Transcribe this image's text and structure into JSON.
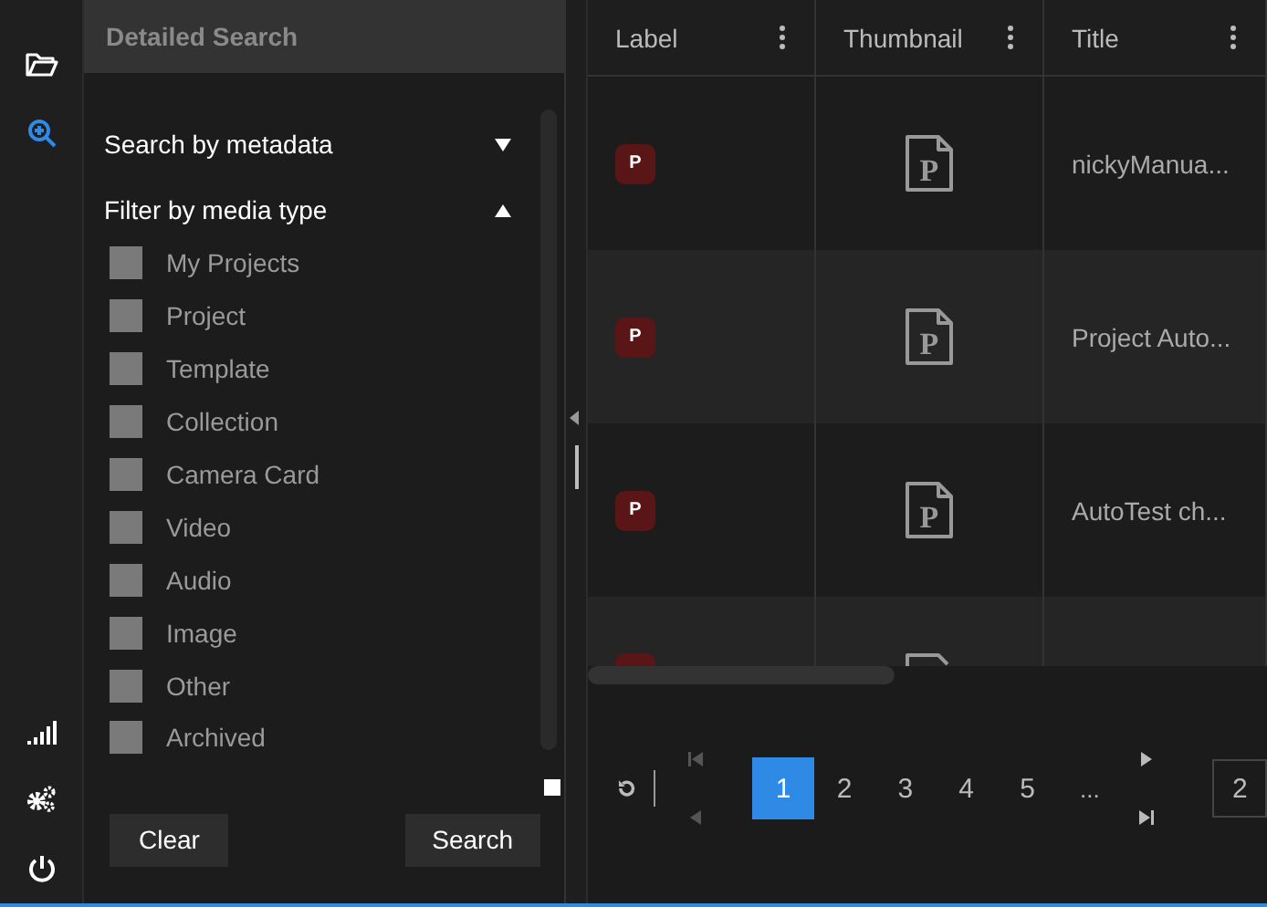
{
  "rail": {
    "items": [
      {
        "kind": "folder",
        "selected": false
      },
      {
        "kind": "zoom",
        "selected": true
      }
    ],
    "bottom": [
      {
        "kind": "signal"
      },
      {
        "kind": "gears"
      },
      {
        "kind": "power"
      }
    ]
  },
  "panel": {
    "title": "Detailed Search",
    "sections": [
      {
        "label": "Search by metadata",
        "expanded": false
      },
      {
        "label": "Filter by media type",
        "expanded": true
      }
    ],
    "media_types": [
      {
        "label": "My Projects",
        "checked": false
      },
      {
        "label": "Project",
        "checked": false
      },
      {
        "label": "Template",
        "checked": false
      },
      {
        "label": "Collection",
        "checked": false
      },
      {
        "label": "Camera Card",
        "checked": false
      },
      {
        "label": "Video",
        "checked": false
      },
      {
        "label": "Audio",
        "checked": false
      },
      {
        "label": "Image",
        "checked": false
      },
      {
        "label": "Other",
        "checked": false
      },
      {
        "label": "Archived",
        "checked": false
      }
    ],
    "buttons": [
      "Clear",
      "Search"
    ]
  },
  "table": {
    "columns": [
      "Label",
      "Thumbnail",
      "Title"
    ],
    "rows": [
      {
        "badge": "P",
        "thumbnail": "P",
        "title": "nickyManua..."
      },
      {
        "badge": "P",
        "thumbnail": "P",
        "title": "Project Auto..."
      },
      {
        "badge": "P",
        "thumbnail": "P",
        "title": "AutoTest ch..."
      },
      {}
    ]
  },
  "pagination": {
    "pages": [
      {
        "label": "1",
        "selected": true
      },
      {
        "label": "2",
        "selected": false
      },
      {
        "label": "3",
        "selected": false
      },
      {
        "label": "4",
        "selected": false
      },
      {
        "label": "5",
        "selected": false
      }
    ],
    "ellipsis": "...",
    "back_disabled": true,
    "forward_disabled": false,
    "jump_value": "2"
  }
}
